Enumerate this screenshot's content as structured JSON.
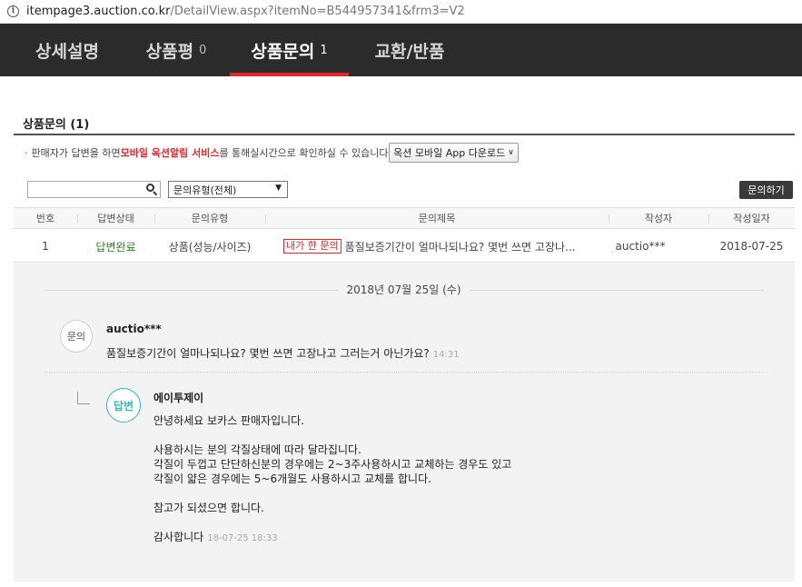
{
  "browser": {
    "url_host": "itempage3.auction.co.kr",
    "url_path": "/DetailView.aspx?itemNo=B544957341&frm3=V2"
  },
  "tabs": [
    {
      "label": "상세설명",
      "count": ""
    },
    {
      "label": "상품평",
      "count": "0"
    },
    {
      "label": "상품문의",
      "count": "1"
    },
    {
      "label": "교환/반품",
      "count": ""
    }
  ],
  "section": {
    "title": "상품문의 (1)",
    "notice_before": "판매자가 답변을 하면 ",
    "notice_highlight": "모바일 옥션알림 서비스",
    "notice_after": "를 통해실시간으로 확인하실 수 있습니다.",
    "download_button": "옥션 모바일 App 다운로드"
  },
  "filters": {
    "search_placeholder": "",
    "type_select": "문의유형(전체)",
    "ask_button": "문의하기"
  },
  "table": {
    "headers": [
      "번호",
      "답변상태",
      "문의유형",
      "문의제목",
      "작성자",
      "작성일자"
    ],
    "rows": [
      {
        "no": "1",
        "status": "답변완료",
        "type": "상품(성능/사이즈)",
        "badge": "내가 한 문의",
        "title": "품질보증기간이 얼마나되나요? 몇번 쓰면 고장나...",
        "author": "auctio***",
        "date": "2018-07-25"
      }
    ]
  },
  "detail": {
    "date": "2018년 07월 25일 (수)",
    "question": {
      "avatar_label": "문의",
      "author": "auctio***",
      "text": "품질보증기간이 얼마나되나요? 몇번 쓰면 고장나고 그러는거 아닌가요?",
      "time": "14:31"
    },
    "answer": {
      "avatar_label": "답변",
      "author": "에이투제이",
      "lines": [
        "안녕하세요 보카스 판매자입니다.",
        "",
        "사용하시는 분의 각질상태에 따라 달라집니다.",
        "각질이 두껍고 단단하신분의 경우에는 2~3주사용하시고 교체하는 경우도 있고",
        "각질이 얇은 경우에는 5~6개월도 사용하시고 교체를 합니다.",
        "",
        "참고가 되셨으면 합니다.",
        "",
        "감사합니다"
      ],
      "time": "18-07-25 18:33"
    }
  },
  "colors": {
    "accent_red": "#e8262b",
    "tab_bg": "#2b2b2b",
    "answer_teal": "#2bbbc1",
    "status_green": "#2e7d1e"
  }
}
